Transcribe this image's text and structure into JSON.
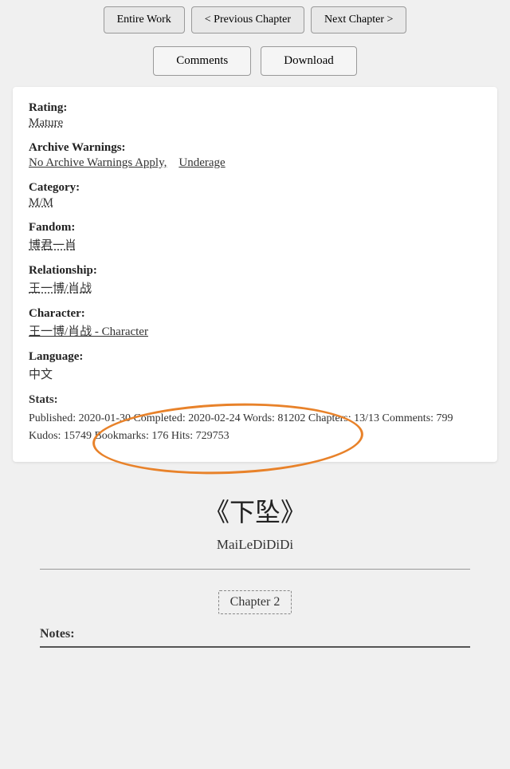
{
  "nav": {
    "entire_work_label": "Entire Work",
    "prev_chapter_label": "< Previous Chapter",
    "next_chapter_label": "Next Chapter >"
  },
  "actions": {
    "comments_label": "Comments",
    "download_label": "Download"
  },
  "info": {
    "rating_label": "Rating:",
    "rating_value": "Mature",
    "archive_warnings_label": "Archive Warnings:",
    "aw_item1": "No Archive Warnings Apply,",
    "aw_item2": "Underage",
    "category_label": "Category:",
    "category_value": "M/M",
    "fandom_label": "Fandom:",
    "fandom_value": "博君一肖",
    "relationship_label": "Relationship:",
    "relationship_value": "王一博/肖战",
    "character_label": "Character:",
    "character_value": "王一博/肖战 - Character",
    "language_label": "Language:",
    "language_value": "中文",
    "stats_label": "Stats:",
    "stats_text": "Published:  2020-01-30    Completed:  2020-02-24    Words:  81202    Chapters: 13/13    Comments: 799    Kudos:  15749    Bookmarks:  176    Hits:  729753"
  },
  "work": {
    "title": "《下坠》",
    "author": "MaiLeDiDiDi",
    "chapter_label": "Chapter 2",
    "notes_label": "Notes:"
  }
}
